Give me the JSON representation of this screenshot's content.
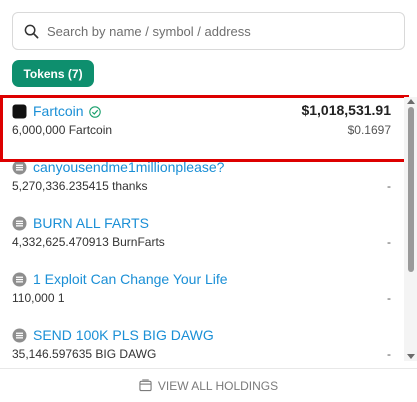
{
  "search": {
    "placeholder": "Search by name / symbol / address"
  },
  "tabs": {
    "tokens_label": "Tokens (7)"
  },
  "holdings": [
    {
      "name": "Fartcoin",
      "amount": "6,000,000 Fartcoin",
      "value": "$1,018,531.91",
      "price": "$0.1697",
      "verified": true,
      "icon": "black-square-icon"
    },
    {
      "name": "canyousendme1millionplease?",
      "amount": "5,270,336.235415 thanks",
      "value": "",
      "price": "-",
      "verified": false,
      "icon": "generic-token-icon"
    },
    {
      "name": "BURN ALL FARTS",
      "amount": "4,332,625.470913 BurnFarts",
      "value": "",
      "price": "-",
      "verified": false,
      "icon": "generic-token-icon"
    },
    {
      "name": "1 Exploit Can Change Your Life",
      "amount": "110,000 1",
      "value": "",
      "price": "-",
      "verified": false,
      "icon": "generic-token-icon"
    },
    {
      "name": "SEND 100K PLS BIG DAWG",
      "amount": "35,146.597635 BIG DAWG",
      "value": "",
      "price": "-",
      "verified": false,
      "icon": "generic-token-icon"
    }
  ],
  "footer": {
    "view_all_label": "VIEW ALL HOLDINGS"
  },
  "colors": {
    "accent": "#0e8f6e",
    "link": "#1a8fd6",
    "highlight": "#dd0000"
  }
}
